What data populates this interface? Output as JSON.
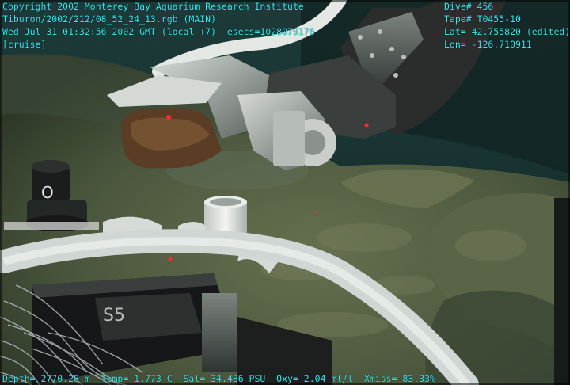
{
  "overlay": {
    "top_left": {
      "copyright": "Copyright 2002 Monterey Bay Aquarium Research Institute",
      "file": "Tiburon/2002/212/08_52_24_13.rgb (MAIN)",
      "datetime": "Wed Jul 31 01:32:56 2002 GMT (local +7)  esecs=1028079176",
      "mode": "[cruise]"
    },
    "top_right": {
      "dive": "Dive# 456",
      "tape": "Tape# T0455-10",
      "lat": "Lat= 42.755820 (edited)",
      "lon": "Lon= -126.710911"
    },
    "bottom": {
      "telemetry": "Depth= 2770.28 m  Temp= 1.773 C  Sal= 34.486 PSU  Oxy= 2.04 ml/l  Xmiss= 83.33%"
    }
  },
  "scene": {
    "tray_label": "S5",
    "colors": {
      "overlay_text": "#33e8ee",
      "water": "#16302f",
      "seafloor": "#4c5a3e",
      "laser": "#ff2a2a"
    }
  }
}
